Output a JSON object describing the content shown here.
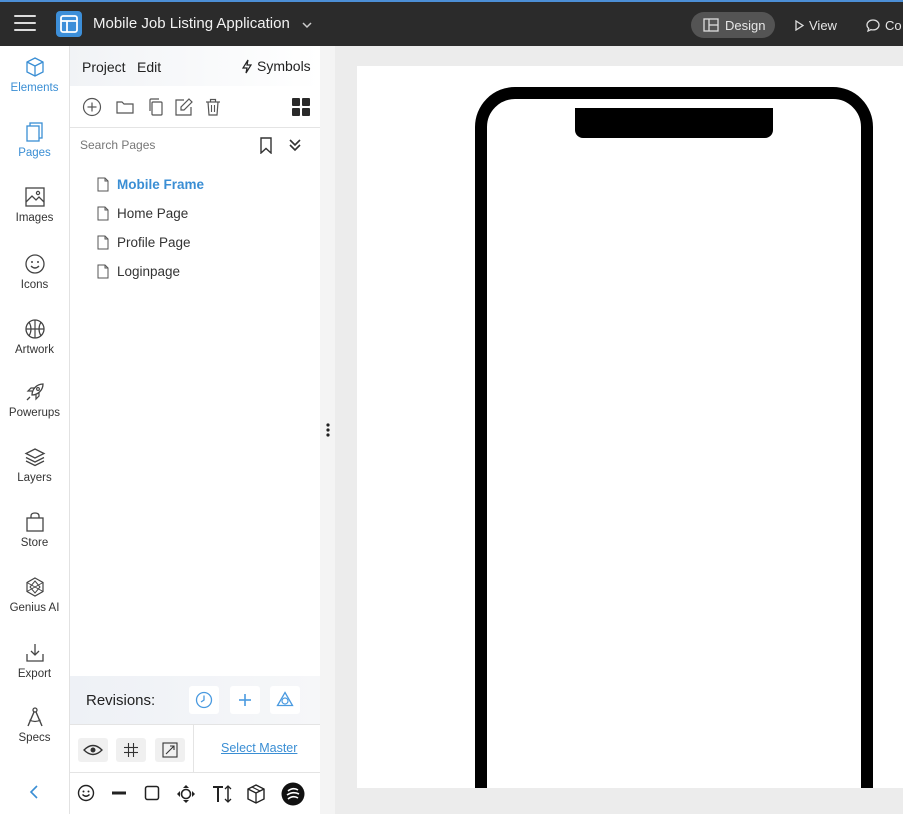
{
  "app": {
    "project_title": "Mobile Job Listing Application",
    "design_label": "Design",
    "view_label": "View",
    "comment_label": "Co",
    "accent_color": "#3a8ed4"
  },
  "leftnav": {
    "items": [
      {
        "label": "Elements",
        "icon": "cube-icon",
        "active": true
      },
      {
        "label": "Pages",
        "icon": "pages-icon",
        "active": false
      },
      {
        "label": "Images",
        "icon": "image-icon",
        "active": false
      },
      {
        "label": "Icons",
        "icon": "smiley-icon",
        "active": false
      },
      {
        "label": "Artwork",
        "icon": "basketball-icon",
        "active": false
      },
      {
        "label": "Powerups",
        "icon": "rocket-icon",
        "active": false
      },
      {
        "label": "Layers",
        "icon": "layers-icon",
        "active": false
      },
      {
        "label": "Store",
        "icon": "shopping-bag-icon",
        "active": false
      },
      {
        "label": "Genius AI",
        "icon": "sparkle-icon",
        "active": false
      },
      {
        "label": "Export",
        "icon": "download-icon",
        "active": false
      },
      {
        "label": "Specs",
        "icon": "compass-icon",
        "active": false
      }
    ]
  },
  "panel": {
    "tab_project": "Project",
    "tab_edit": "Edit",
    "symbols_label": "Symbols",
    "search_placeholder": "Search Pages",
    "pages": [
      {
        "name": "Mobile Frame",
        "active": true
      },
      {
        "name": "Home Page",
        "active": false
      },
      {
        "name": "Profile Page",
        "active": false
      },
      {
        "name": "Loginpage",
        "active": false
      }
    ],
    "revisions_label": "Revisions:",
    "select_master_label": "Select Master"
  }
}
